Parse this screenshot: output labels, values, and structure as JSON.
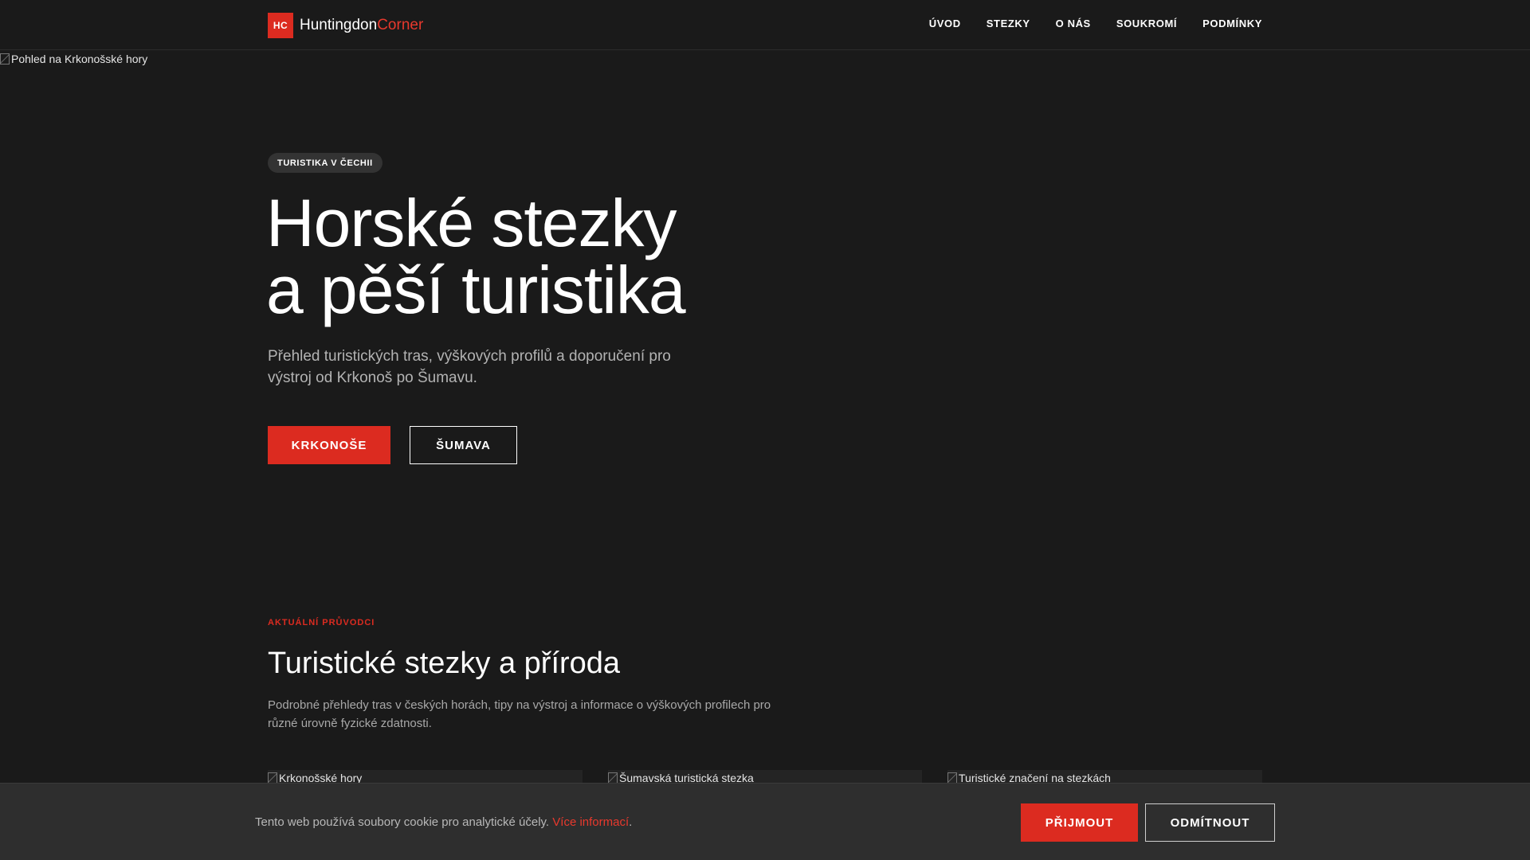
{
  "header": {
    "logo_badge": "HC",
    "logo_primary": "Huntingdon",
    "logo_accent": "Corner",
    "nav": [
      "ÚVOD",
      "STEZKY",
      "O NÁS",
      "SOUKROMÍ",
      "PODMÍNKY"
    ]
  },
  "hero": {
    "image_alt": "Pohled na Krkonošské hory",
    "badge": "TURISTIKA V ČECHII",
    "title_line1": "Horské stezky",
    "title_line2": "a pěší turistika",
    "subtitle": "Přehled turistických tras, výškových profilů a doporučení pro výstroj od Krkonoš po Šumavu.",
    "button_primary": "KRKONOŠE",
    "button_secondary": "ŠUMAVA"
  },
  "section": {
    "eyebrow": "AKTUÁLNÍ PRŮVODCI",
    "title": "Turistické stezky a příroda",
    "description": "Podrobné přehledy tras v českých horách, tipy na výstroj a informace o výškových profilech pro různé úrovně fyzické zdatnosti.",
    "cards": [
      {
        "image_alt": "Krkonošské hory"
      },
      {
        "image_alt": "Šumavská turistická stezka"
      },
      {
        "image_alt": "Turistické značení na stezkách"
      }
    ]
  },
  "cookie": {
    "text": "Tento web používá soubory cookie pro analytické účely.",
    "link": "Více informací",
    "period": ".",
    "accept": "PŘIJMOUT",
    "reject": "ODMÍTNOUT"
  },
  "colors": {
    "background": "#1a1a1a",
    "accent": "#dc2b20",
    "cookie_bar": "#2e2e2e"
  }
}
